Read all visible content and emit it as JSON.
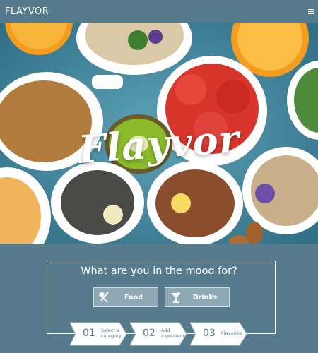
{
  "header": {
    "logo": "FLAYVOR",
    "menu_icon": "hamburger-menu-icon"
  },
  "hero": {
    "title": "Flayvor"
  },
  "mood": {
    "question": "What are you in the mood for?",
    "buttons": [
      {
        "label": "Food",
        "icon": "fork-knife-icon"
      },
      {
        "label": "Drinks",
        "icon": "cocktail-glass-icon"
      }
    ]
  },
  "steps": [
    {
      "number": "01",
      "label_line1": "Select a",
      "label_line2": "category"
    },
    {
      "number": "02",
      "label_line1": "Add",
      "label_line2": "Ingredients"
    },
    {
      "number": "03",
      "label_line1": "Flavorize",
      "label_line2": ""
    }
  ],
  "colors": {
    "background": "#567b8c",
    "button_fill": "#8fa8b5",
    "white": "#ffffff"
  }
}
